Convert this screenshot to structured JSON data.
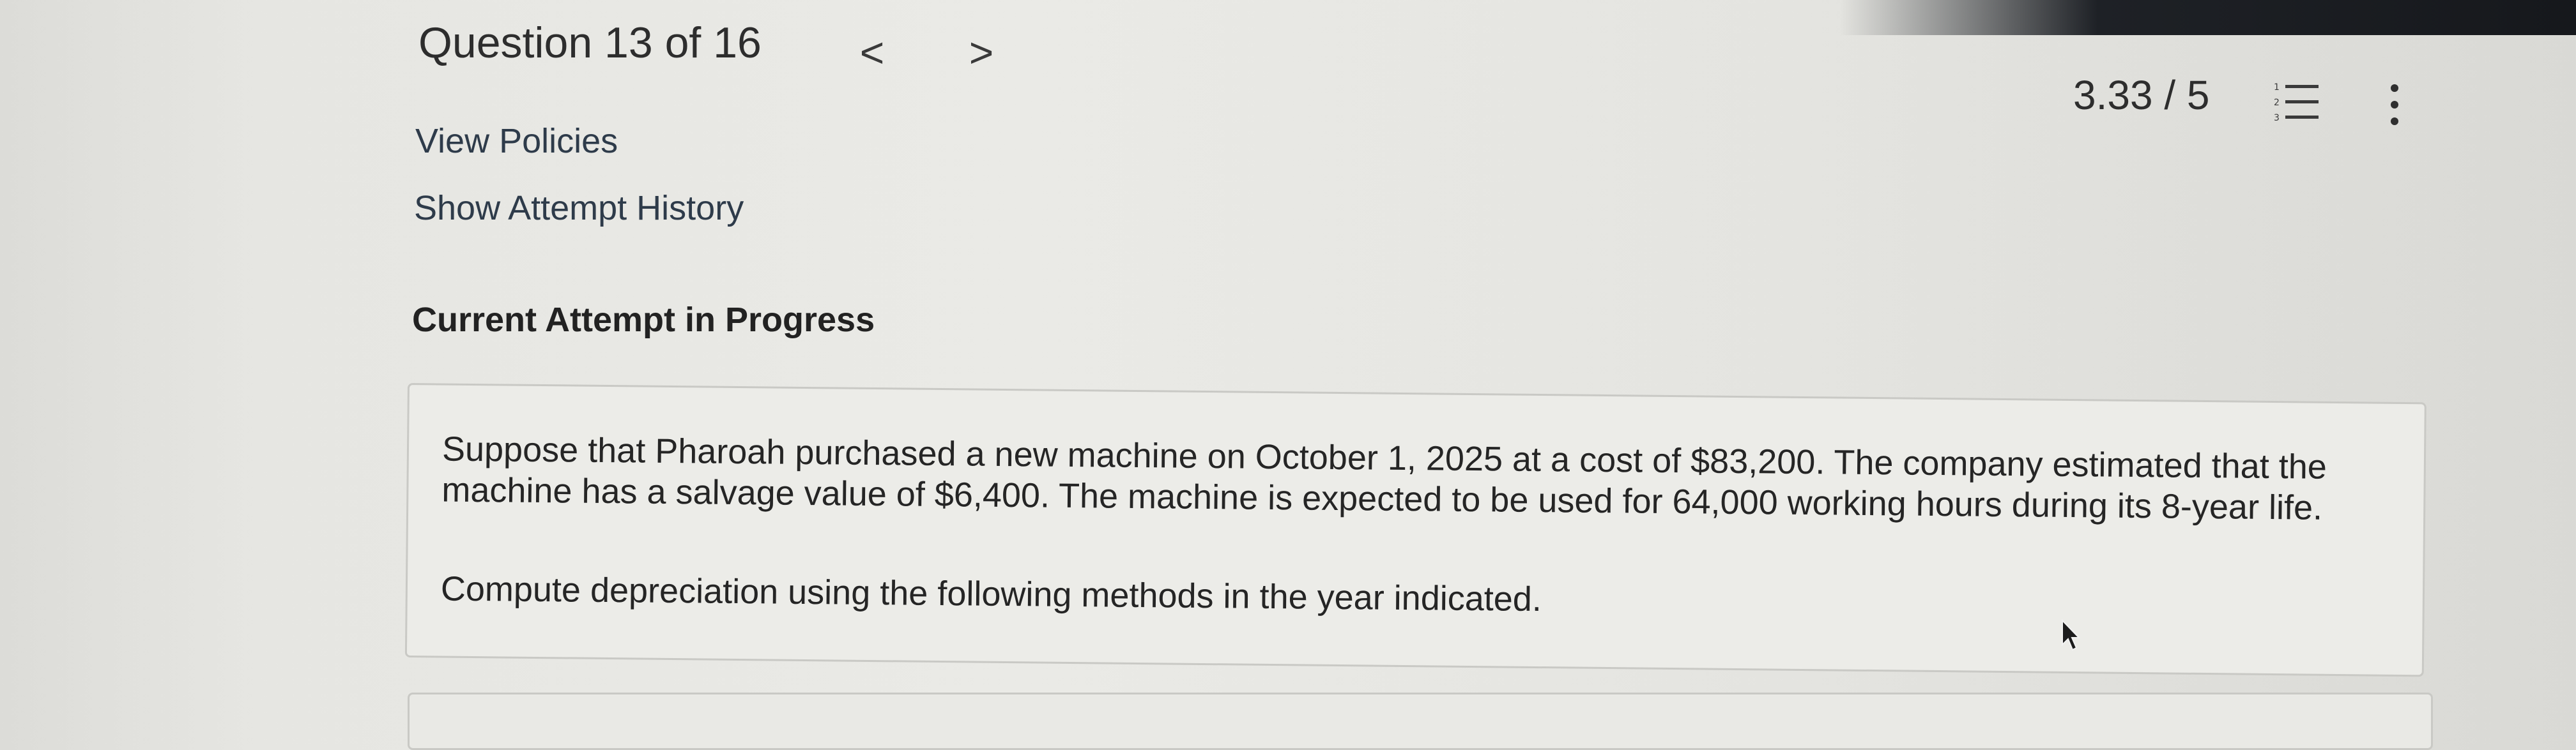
{
  "header": {
    "question_label": "Question 13 of 16",
    "prev_symbol": "<",
    "next_symbol": ">",
    "score": "3.33 / 5"
  },
  "links": {
    "view_policies": "View Policies",
    "attempt_history": "Show Attempt History"
  },
  "section": {
    "heading": "Current Attempt in Progress"
  },
  "question": {
    "body": "Suppose that Pharoah purchased a new machine on October 1, 2025 at a cost of $83,200. The company estimated that the machine has a salvage value of $6,400. The machine is expected to be used for 64,000 working hours during its 8-year life.",
    "instruction": "Compute depreciation using the following methods in the year indicated."
  },
  "icons": {
    "question_list": "numbered-list-icon",
    "more_options": "vertical-ellipsis-icon",
    "pointer": "mouse-cursor-icon"
  }
}
